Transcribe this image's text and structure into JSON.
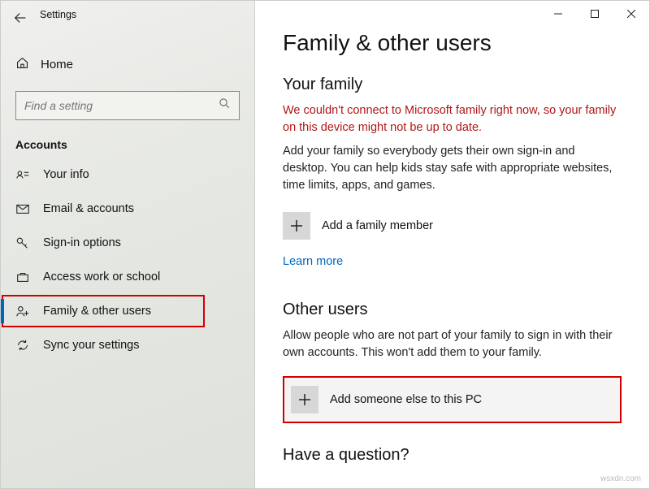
{
  "window": {
    "app_name": "Settings"
  },
  "sidebar": {
    "home_label": "Home",
    "search_placeholder": "Find a setting",
    "section": "Accounts",
    "items": [
      {
        "label": "Your info"
      },
      {
        "label": "Email & accounts"
      },
      {
        "label": "Sign-in options"
      },
      {
        "label": "Access work or school"
      },
      {
        "label": "Family & other users"
      },
      {
        "label": "Sync your settings"
      }
    ]
  },
  "main": {
    "title": "Family & other users",
    "family": {
      "heading": "Your family",
      "error": "We couldn't connect to Microsoft family right now, so your family on this device might not be up to date.",
      "desc": "Add your family so everybody gets their own sign-in and desktop. You can help kids stay safe with appropriate websites, time limits, apps, and games.",
      "add_label": "Add a family member",
      "learn_more": "Learn more"
    },
    "other": {
      "heading": "Other users",
      "desc": "Allow people who are not part of your family to sign in with their own accounts. This won't add them to your family.",
      "add_label": "Add someone else to this PC"
    },
    "question_heading": "Have a question?"
  },
  "watermark": "wsxdn.com"
}
